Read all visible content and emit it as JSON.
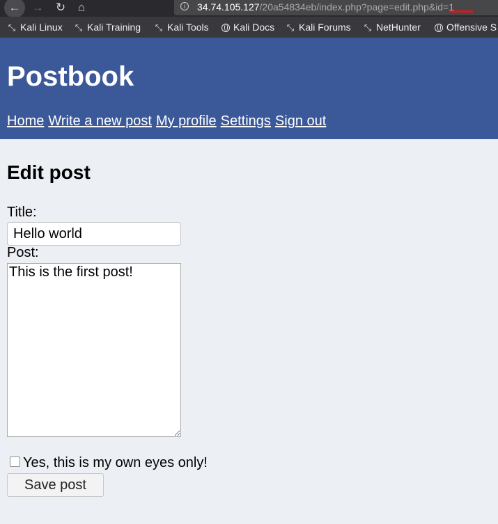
{
  "browser": {
    "url_host": "34.74.105.127",
    "url_path": "/20a54834eb/index.php?page=edit.php&id=1",
    "bookmarks": [
      {
        "label": "Kali Linux",
        "icon": "kali-dragon-icon"
      },
      {
        "label": "Kali Training",
        "icon": "kali-dragon-icon"
      },
      {
        "label": "Kali Tools",
        "icon": "kali-dragon-icon"
      },
      {
        "label": "Kali Docs",
        "icon": "globe-icon"
      },
      {
        "label": "Kali Forums",
        "icon": "kali-dragon-icon"
      },
      {
        "label": "NetHunter",
        "icon": "kali-dragon-icon"
      },
      {
        "label": "Offensive S",
        "icon": "globe-icon"
      }
    ],
    "highlight_color": "#e0141e"
  },
  "site": {
    "title": "Postbook",
    "header_color": "#3b5998",
    "nav": [
      "Home",
      "Write a new post",
      "My profile",
      "Settings",
      "Sign out"
    ]
  },
  "form": {
    "heading": "Edit post",
    "title_label": "Title:",
    "title_value": "Hello world",
    "post_label": "Post:",
    "post_value": "This is the first post!",
    "private_label": "Yes, this is my own eyes only!",
    "private_checked": false,
    "save_label": "Save post"
  }
}
